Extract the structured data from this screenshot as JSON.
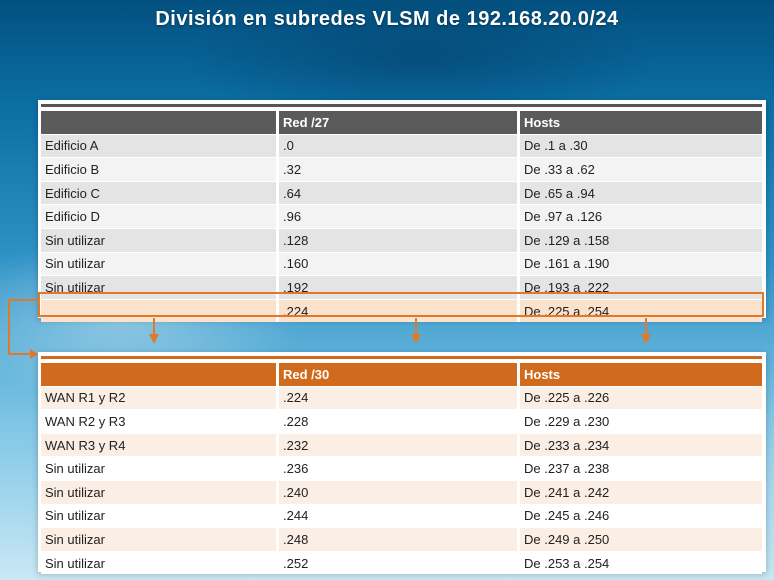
{
  "title": "División en subredes VLSM de 192.168.20.0/24",
  "colors": {
    "accent": "#d06a1d",
    "header_gray": "#5b5b5b",
    "highlight": "#fbe2cd"
  },
  "table1": {
    "headers": [
      "",
      "Red /27",
      "Hosts"
    ],
    "rows": [
      [
        "Edificio A",
        ".0",
        "De .1 a .30"
      ],
      [
        "Edificio B",
        ".32",
        "De .33 a .62"
      ],
      [
        "Edificio C",
        ".64",
        "De .65 a .94"
      ],
      [
        "Edificio D",
        ".96",
        "De .97 a .126"
      ],
      [
        "Sin utilizar",
        ".128",
        "De .129 a .158"
      ],
      [
        "Sin utilizar",
        ".160",
        "De .161 a .190"
      ],
      [
        "Sin utilizar",
        ".192",
        "De .193 a .222"
      ],
      [
        "",
        ".224",
        "De .225 a .254"
      ]
    ]
  },
  "table2": {
    "headers": [
      "",
      "Red /30",
      "Hosts"
    ],
    "rows": [
      [
        "WAN R1 y R2",
        ".224",
        "De .225 a .226"
      ],
      [
        "WAN R2 y R3",
        ".228",
        "De .229 a .230"
      ],
      [
        "WAN R3 y R4",
        ".232",
        "De .233 a .234"
      ],
      [
        "Sin utilizar",
        ".236",
        "De .237 a .238"
      ],
      [
        "Sin utilizar",
        ".240",
        "De .241 a .242"
      ],
      [
        "Sin utilizar",
        ".244",
        "De .245 a .246"
      ],
      [
        "Sin utilizar",
        ".248",
        "De .249 a .250"
      ],
      [
        "Sin utilizar",
        ".252",
        "De .253 a .254"
      ]
    ]
  }
}
